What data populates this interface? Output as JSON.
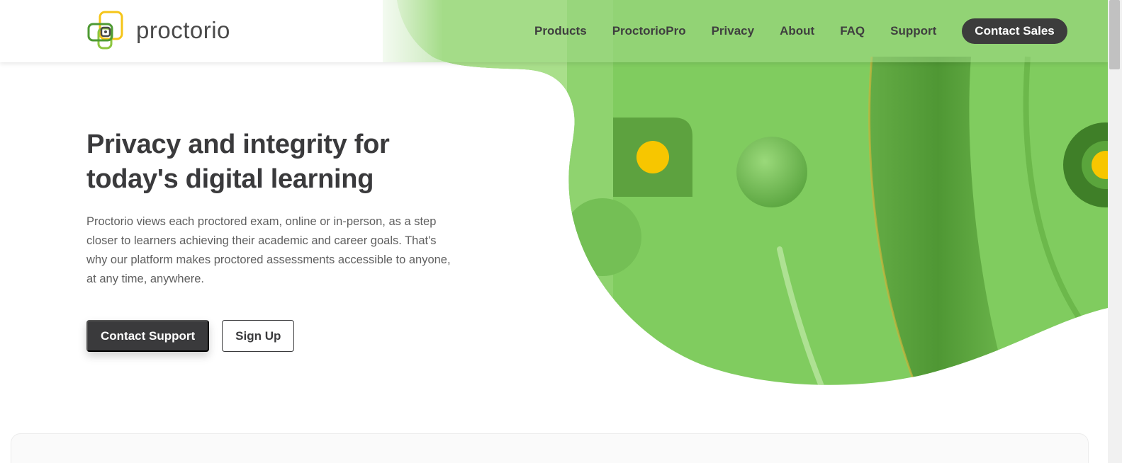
{
  "brand": {
    "name": "proctorio",
    "accent": "#7fc95f",
    "dark": "#3a3a3c",
    "logo_green": "#6fbf3f",
    "logo_yellow": "#f5c518"
  },
  "nav": {
    "items": [
      {
        "label": "Products"
      },
      {
        "label": "ProctorioPro"
      },
      {
        "label": "Privacy"
      },
      {
        "label": "About"
      },
      {
        "label": "FAQ"
      },
      {
        "label": "Support"
      }
    ],
    "cta_label": "Contact Sales"
  },
  "hero": {
    "title_line1": "Privacy and integrity for",
    "title_line2": "today's digital learning",
    "description": "Proctorio views each proctored exam, online or in-person, as a step closer to learners achieving their academic and career goals. That's why our platform makes proctored assessments accessible to anyone, at any time, anywhere.",
    "primary_button": "Contact Support",
    "secondary_button": "Sign Up"
  },
  "colors": {
    "hero_green": "#7fcb5e",
    "hero_green_light": "#a8dd8a",
    "hero_green_dark": "#56a03a",
    "dot_yellow": "#f7c600"
  }
}
